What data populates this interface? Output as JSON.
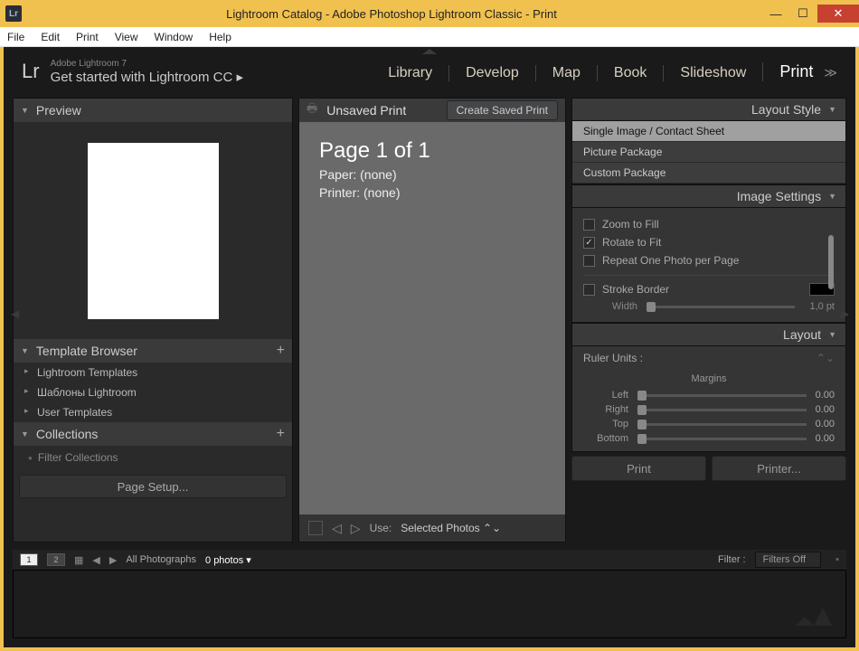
{
  "titlebar": {
    "icon_text": "Lr",
    "title": "Lightroom Catalog - Adobe Photoshop Lightroom Classic - Print"
  },
  "menubar": [
    "File",
    "Edit",
    "Print",
    "View",
    "Window",
    "Help"
  ],
  "brand": {
    "lr": "Lr",
    "sub": "Adobe Lightroom 7",
    "main": "Get started with Lightroom CC ▸"
  },
  "modules": [
    "Library",
    "Develop",
    "Map",
    "Book",
    "Slideshow",
    "Print"
  ],
  "active_module": "Print",
  "left": {
    "preview_label": "Preview",
    "template_browser_label": "Template Browser",
    "templates": [
      "Lightroom Templates",
      "Шаблоны Lightroom",
      "User Templates"
    ],
    "collections_label": "Collections",
    "filter_collections": "Filter Collections",
    "page_setup": "Page Setup..."
  },
  "center": {
    "unsaved": "Unsaved Print",
    "create_saved": "Create Saved Print",
    "page_title": "Page 1 of 1",
    "paper": "Paper:  (none)",
    "printer": "Printer:  (none)",
    "use_label": "Use:",
    "use_value": "Selected Photos"
  },
  "right": {
    "layout_style_label": "Layout Style",
    "layout_style_items": [
      "Single Image / Contact Sheet",
      "Picture Package",
      "Custom Package"
    ],
    "layout_style_selected": "Single Image / Contact Sheet",
    "image_settings_label": "Image Settings",
    "zoom_to_fill": "Zoom to Fill",
    "rotate_to_fit": "Rotate to Fit",
    "repeat_one": "Repeat One Photo per Page",
    "stroke_border": "Stroke Border",
    "width_label": "Width",
    "width_value": "1,0 pt",
    "layout_label": "Layout",
    "ruler_units": "Ruler Units :",
    "margins_label": "Margins",
    "margins": {
      "left_label": "Left",
      "left_val": "0.00",
      "right_label": "Right",
      "right_val": "0.00",
      "top_label": "Top",
      "top_val": "0.00",
      "bottom_label": "Bottom",
      "bottom_val": "0.00"
    },
    "print_btn": "Print",
    "printer_btn": "Printer..."
  },
  "filmstrip": {
    "all_photos": "All Photographs",
    "count": "0 photos",
    "filter_label": "Filter :",
    "filter_value": "Filters Off"
  }
}
